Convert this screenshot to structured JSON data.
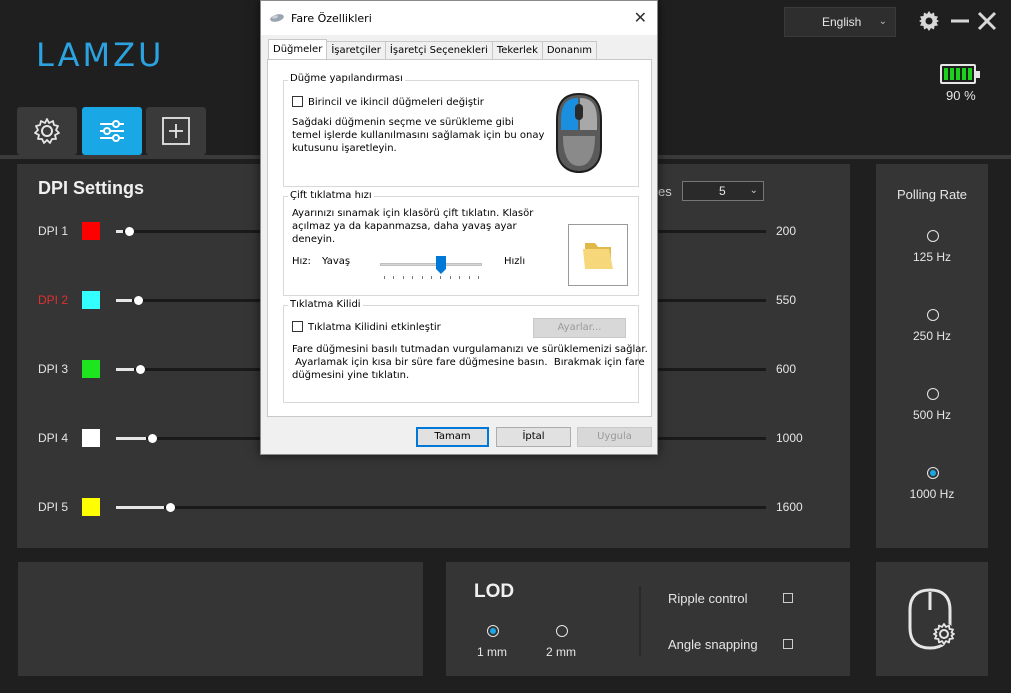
{
  "app": {
    "logo": "LAMZU",
    "language": "English",
    "battery_text": "90 %",
    "battery_level_percent": 90,
    "accent": "#1aa7e6"
  },
  "nav_tabs": [
    {
      "icon": "gear-icon",
      "active": false
    },
    {
      "icon": "sliders-icon",
      "active": true
    },
    {
      "icon": "plus-box-icon",
      "active": false
    }
  ],
  "dpi": {
    "title": "DPI Settings",
    "profiles_label": "es",
    "profiles_value": "5",
    "rows": [
      {
        "label": "DPI 1",
        "color": "#ff0000",
        "value": "200",
        "level": 0.01,
        "active": false
      },
      {
        "label": "DPI 2",
        "color": "#33ffff",
        "value": "550",
        "level": 0.025,
        "active": true
      },
      {
        "label": "DPI 3",
        "color": "#1ee61e",
        "value": "600",
        "level": 0.028,
        "active": false
      },
      {
        "label": "DPI 4",
        "color": "#ffffff",
        "value": "1000",
        "level": 0.046,
        "active": false
      },
      {
        "label": "DPI 5",
        "color": "#ffff00",
        "value": "1600",
        "level": 0.074,
        "active": false
      }
    ]
  },
  "polling": {
    "title": "Polling Rate",
    "options": [
      {
        "label": "125 Hz",
        "selected": false
      },
      {
        "label": "250 Hz",
        "selected": false
      },
      {
        "label": "500 Hz",
        "selected": false
      },
      {
        "label": "1000 Hz",
        "selected": true
      }
    ]
  },
  "lod": {
    "title": "LOD",
    "options": [
      {
        "label": "1 mm",
        "selected": true
      },
      {
        "label": "2 mm",
        "selected": false
      }
    ],
    "ripple_label": "Ripple control",
    "angle_label": "Angle snapping"
  },
  "dialog": {
    "title": "Fare Özellikleri",
    "close": "✕",
    "tabs": [
      "Düğmeler",
      "İşaretçiler",
      "İşaretçi Seçenekleri",
      "Tekerlek",
      "Donanım"
    ],
    "button_config": {
      "group_title": "Düğme yapılandırması",
      "checkbox_label": "Birincil ve ikincil düğmeleri değiştir",
      "description": [
        "Sağdaki düğmenin seçme ve sürükleme gibi",
        "temel işlerde kullanılmasını sağlamak için bu onay",
        "kutusunu işaretleyin."
      ]
    },
    "double_click": {
      "group_title": "Çift tıklatma hızı",
      "description": [
        "Ayarınızı sınamak için klasörü çift tıklatın. Klasör",
        "açılmaz ya da kapanmazsa, daha yavaş ayar",
        "deneyin."
      ],
      "speed_label": "Hız:",
      "slow_label": "Yavaş",
      "fast_label": "Hızlı",
      "speed_level": 0.6
    },
    "click_lock": {
      "group_title": "Tıklatma Kilidi",
      "checkbox_label": "Tıklatma Kilidini etkinleştir",
      "settings_button": "Ayarlar...",
      "description": [
        "Fare düğmesini basılı tutmadan vurgulamanızı ve sürüklemenizi sağlar.",
        " Ayarlamak için kısa bir süre fare düğmesine basın.  Bırakmak için fare",
        "düğmesini yine tıklatın."
      ]
    },
    "buttons": {
      "ok": "Tamam",
      "cancel": "İptal",
      "apply": "Uygula"
    }
  }
}
